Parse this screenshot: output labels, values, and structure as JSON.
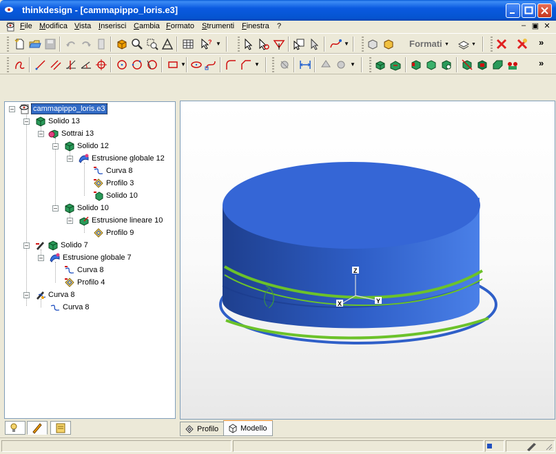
{
  "window": {
    "app_name": "thinkdesign",
    "document_title": "[cammapippo_loris.e3]"
  },
  "menu": {
    "items": [
      "File",
      "Modifica",
      "Vista",
      "Inserisci",
      "Cambia",
      "Formato",
      "Strumenti",
      "Finestra",
      "?"
    ]
  },
  "toolbar": {
    "formati_label": "Formati"
  },
  "tree": {
    "root": "cammapippo_loris.e3",
    "nodes": [
      {
        "label": "Solido 13",
        "icon": "solid-icon"
      },
      {
        "label": "Sottrai 13",
        "icon": "subtract-icon"
      },
      {
        "label": "Solido 12",
        "icon": "solid-icon"
      },
      {
        "label": "Estrusione globale 12",
        "icon": "global-extrusion-icon"
      },
      {
        "label": "Curva 8",
        "icon": "curve-icon"
      },
      {
        "label": "Profilo 3",
        "icon": "profile-icon"
      },
      {
        "label": "Solido 10",
        "icon": "solid-icon"
      },
      {
        "label": "Solido 10",
        "icon": "solid-icon"
      },
      {
        "label": "Estrusione lineare 10",
        "icon": "linear-extrusion-icon"
      },
      {
        "label": "Profilo 9",
        "icon": "profile-icon"
      },
      {
        "label": "Solido 7",
        "icon": "solid-icon"
      },
      {
        "label": "Estrusione globale 7",
        "icon": "global-extrusion-icon"
      },
      {
        "label": "Curva 8",
        "icon": "curve-icon"
      },
      {
        "label": "Profilo 4",
        "icon": "profile-icon"
      },
      {
        "label": "Curva 8",
        "icon": "curve-icon"
      },
      {
        "label": "Curva 8",
        "icon": "curve-icon"
      }
    ]
  },
  "viewport": {
    "axis_labels": {
      "x": "X",
      "y": "Y",
      "z": "Z"
    },
    "colors": {
      "solid_body": "#2f5fc8",
      "solid_top": "#3566d6",
      "curve": "#6cc22a",
      "background": "#ffffff"
    }
  },
  "view_tabs": {
    "profile": "Profilo",
    "model": "Modello",
    "active": "Modello"
  }
}
